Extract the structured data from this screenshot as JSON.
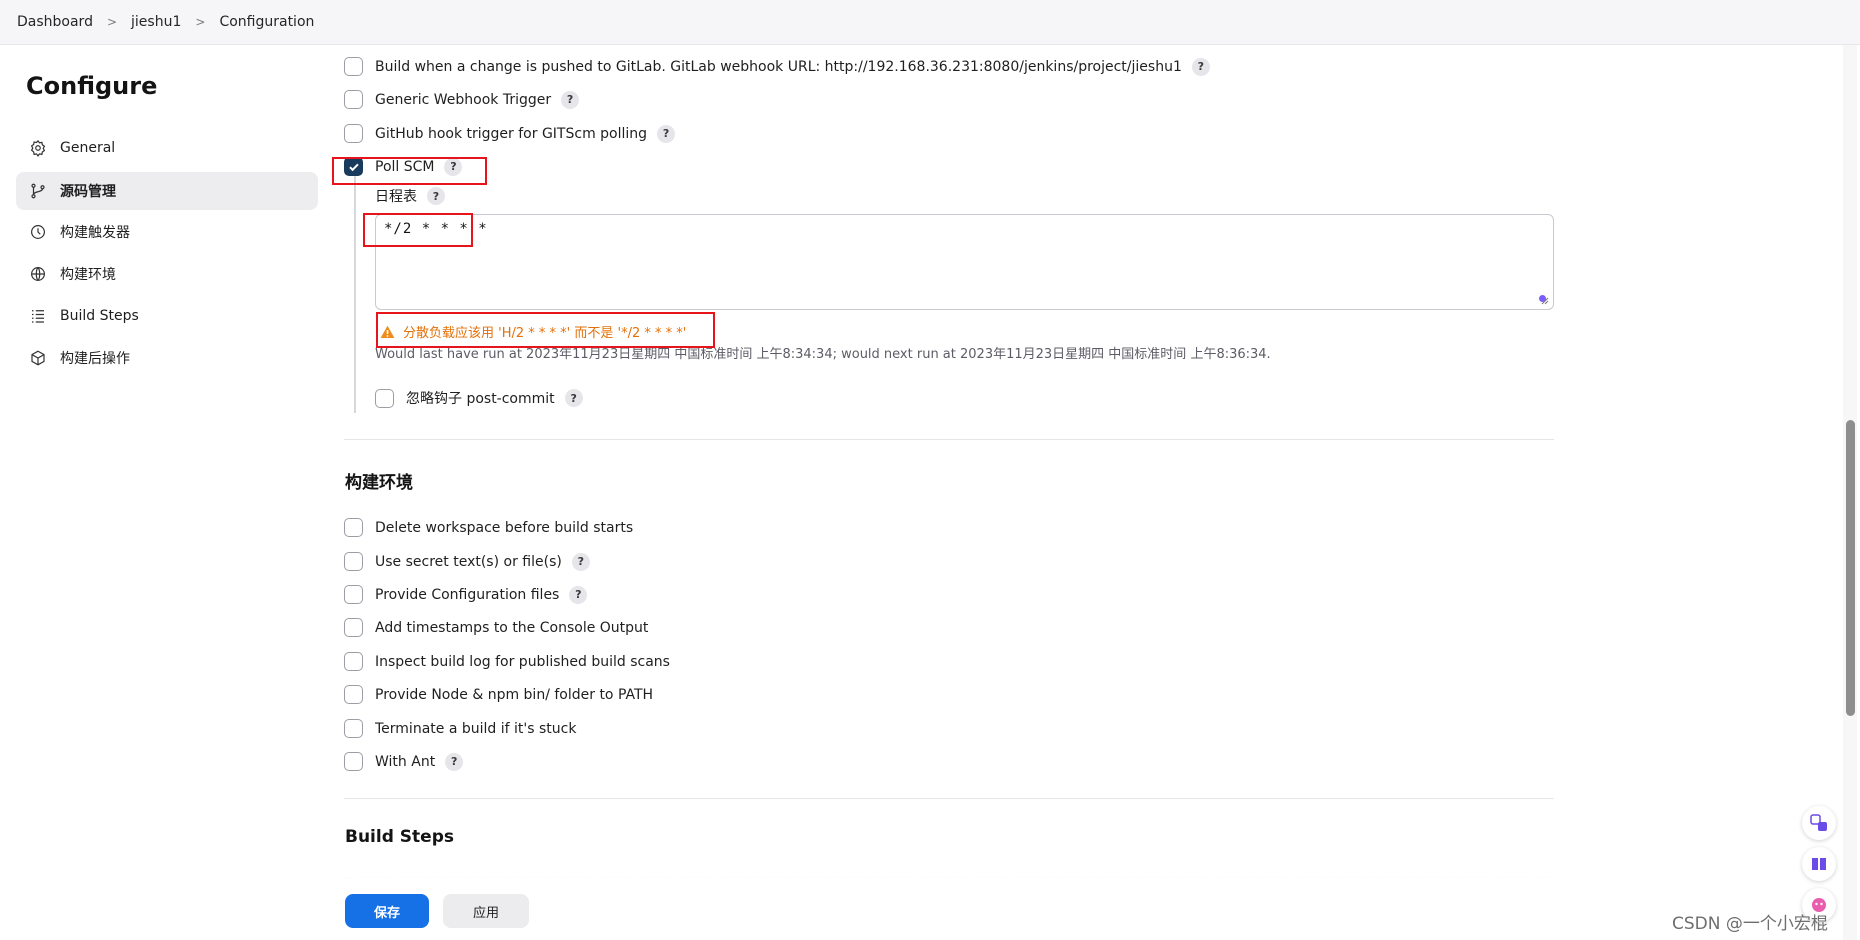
{
  "breadcrumb": {
    "items": [
      "Dashboard",
      "jieshu1",
      "Configuration"
    ],
    "separator": ">"
  },
  "sidebar": {
    "title": "Configure",
    "items": [
      {
        "label": "General",
        "icon": "gear-icon"
      },
      {
        "label": "源码管理",
        "icon": "branch-icon",
        "active": true
      },
      {
        "label": "构建触发器",
        "icon": "clock-icon"
      },
      {
        "label": "构建环境",
        "icon": "globe-icon"
      },
      {
        "label": "Build Steps",
        "icon": "list-icon"
      },
      {
        "label": "构建后操作",
        "icon": "package-icon"
      }
    ]
  },
  "triggers": {
    "items": [
      {
        "label": "Build when a change is pushed to GitLab. GitLab webhook URL: http://192.168.36.231:8080/jenkins/project/jieshu1",
        "checked": false,
        "help": true
      },
      {
        "label": "Generic Webhook Trigger",
        "checked": false,
        "help": true
      },
      {
        "label": "GitHub hook trigger for GITScm polling",
        "checked": false,
        "help": true
      },
      {
        "label": "Poll SCM",
        "checked": true,
        "help": true
      }
    ],
    "poll_scm": {
      "schedule_label": "日程表",
      "schedule_value": "*/2 * * * *",
      "warning": "分散负载应该用 'H/2 * * * *' 而不是 '*/2 * * * *'",
      "status": "Would last have run at 2023年11月23日星期四 中国标准时间 上午8:34:34; would next run at 2023年11月23日星期四 中国标准时间 上午8:36:34.",
      "ignore_post_commit": {
        "label": "忽略钩子 post-commit",
        "checked": false
      }
    }
  },
  "build_env": {
    "title": "构建环境",
    "items": [
      {
        "label": "Delete workspace before build starts",
        "help": false
      },
      {
        "label": "Use secret text(s) or file(s)",
        "help": true
      },
      {
        "label": "Provide Configuration files",
        "help": true
      },
      {
        "label": "Add timestamps to the Console Output",
        "help": false
      },
      {
        "label": "Inspect build log for published build scans",
        "help": false
      },
      {
        "label": "Provide Node & npm bin/ folder to PATH",
        "help": false
      },
      {
        "label": "Terminate a build if it's stuck",
        "help": false
      },
      {
        "label": "With Ant",
        "help": true
      }
    ]
  },
  "build_steps": {
    "title": "Build Steps"
  },
  "footer": {
    "save_label": "保存",
    "apply_label": "应用"
  },
  "help_glyph": "?",
  "watermark": "CSDN @一个小宏棍",
  "colors": {
    "accent": "#1670e6",
    "checked": "#183a5c",
    "warning": "#e27008",
    "highlight_box": "#e8141c"
  }
}
